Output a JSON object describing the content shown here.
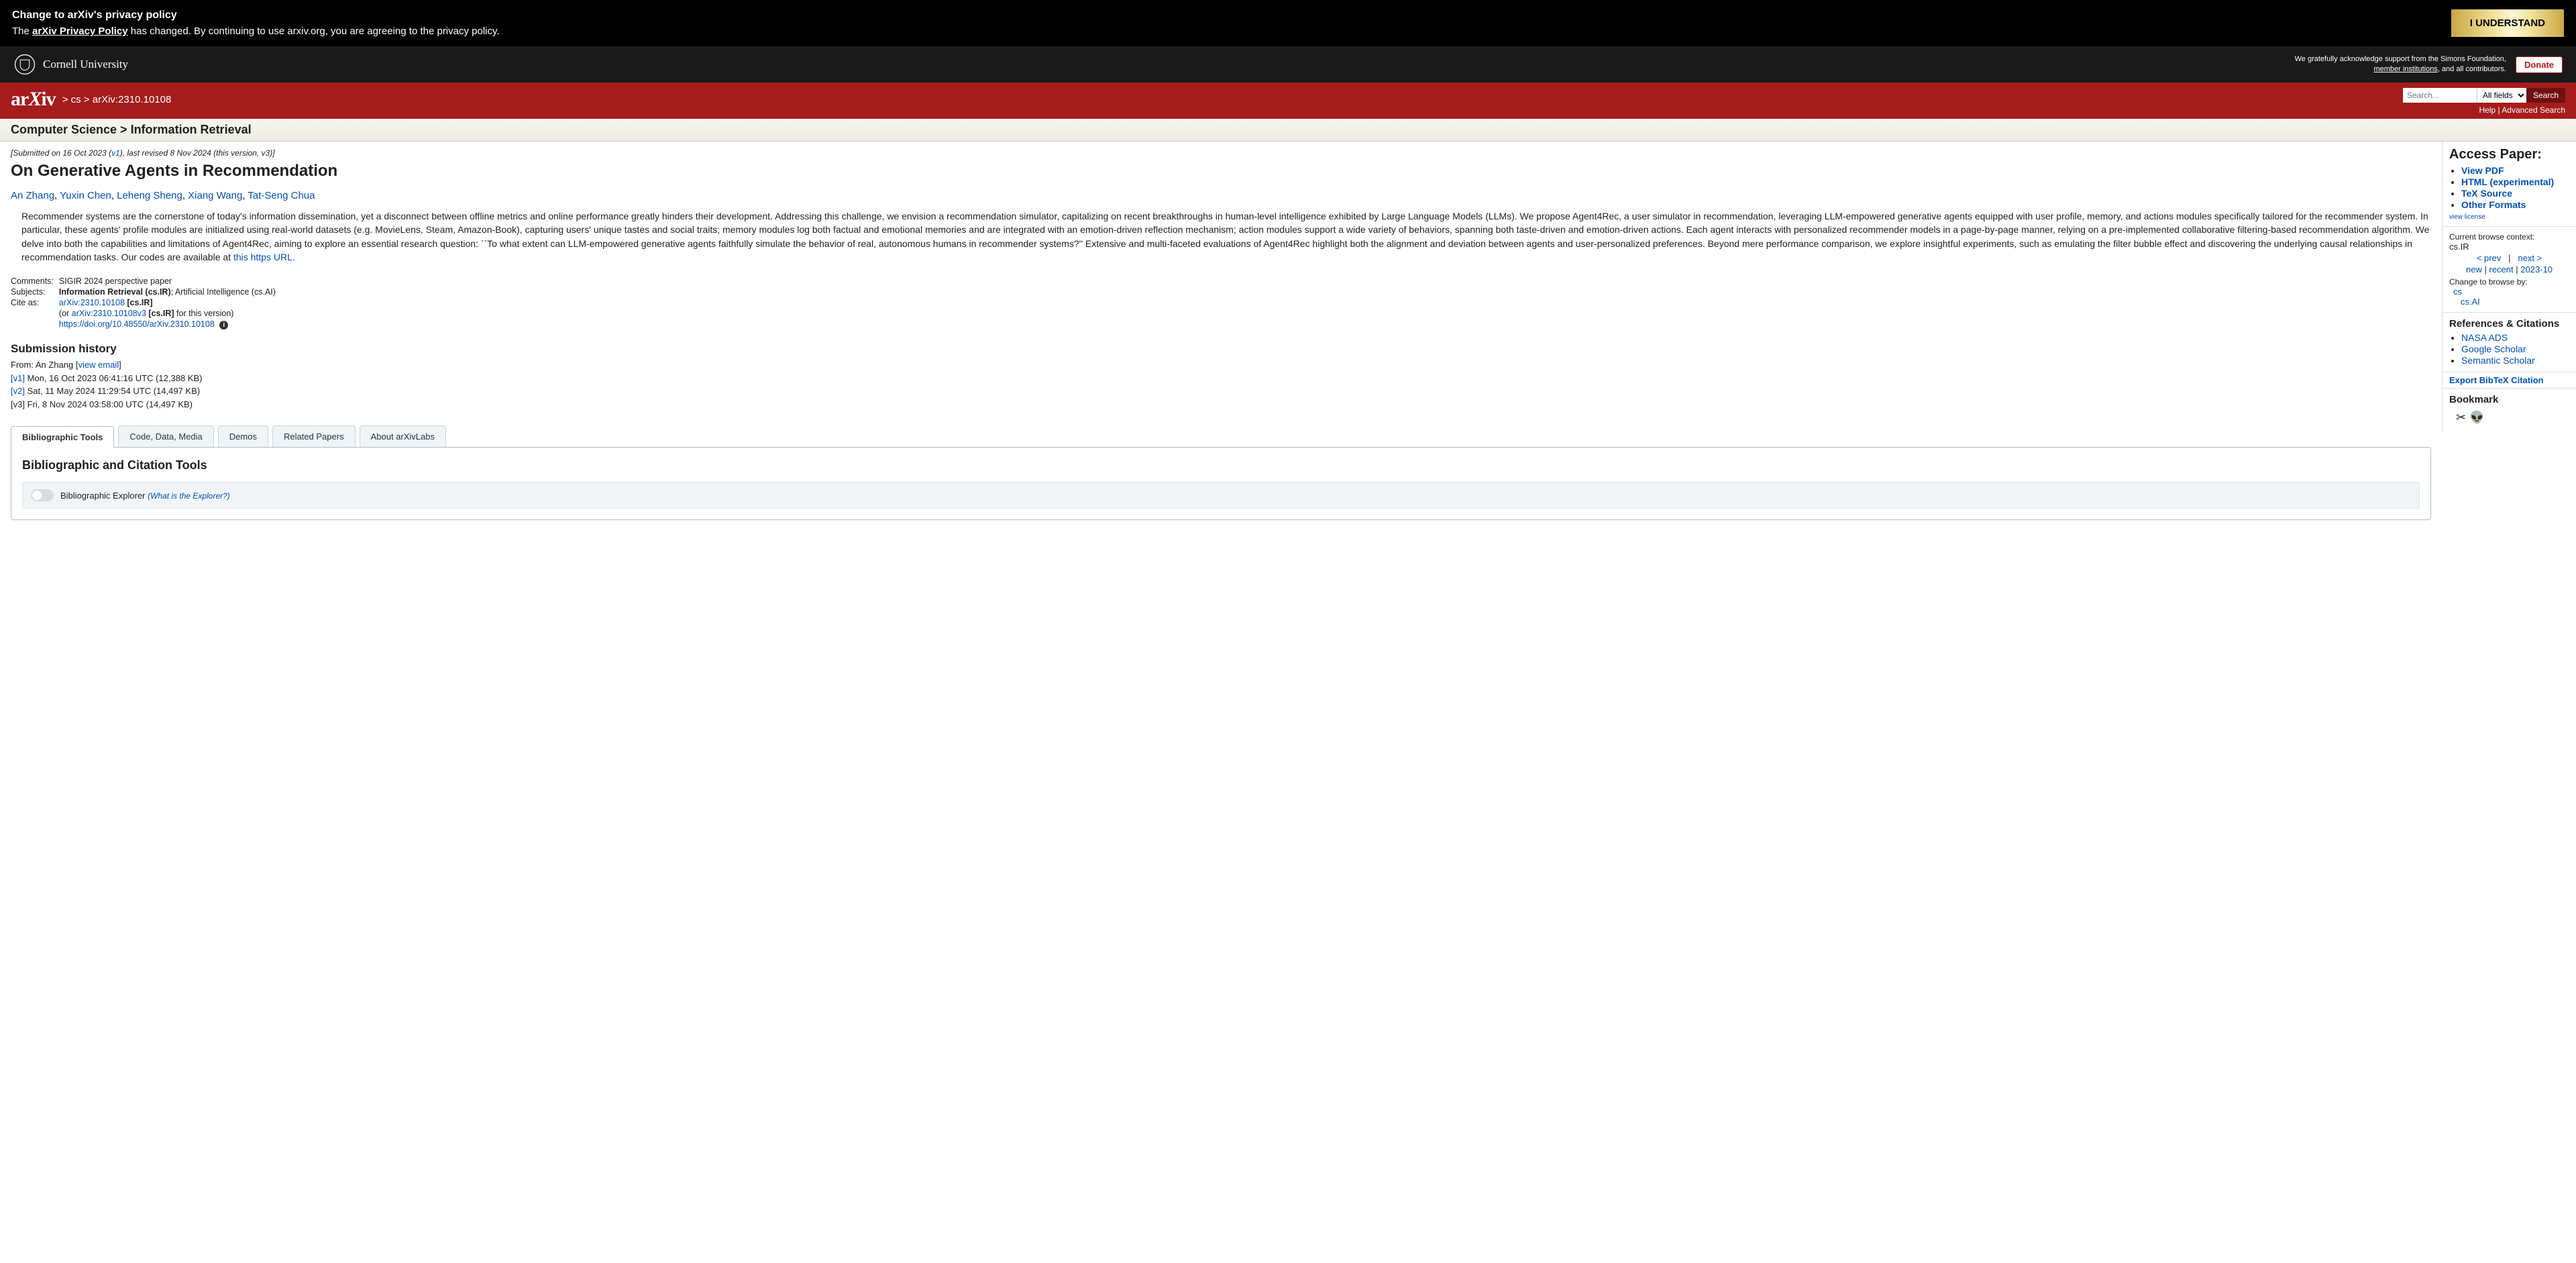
{
  "banner": {
    "title": "Change to arXiv's privacy policy",
    "text_pre": "The ",
    "policy_link": "arXiv Privacy Policy",
    "text_post": " has changed. By continuing to use arxiv.org, you are agreeing to the privacy policy.",
    "button": "I UNDERSTAND"
  },
  "cornell": {
    "name": "Cornell University",
    "ack_line1": "We gratefully acknowledge support from the Simons Foundation,",
    "member_link": "member institutions",
    "ack_line2_post": ", and all contributors.",
    "donate": "Donate"
  },
  "arxivbar": {
    "logo": "arXiv",
    "crumb_cs": "cs",
    "crumb_id": "arXiv:2310.10108",
    "search_placeholder": "Search...",
    "select_value": "All fields",
    "search_btn": "Search",
    "help": "Help",
    "advanced": "Advanced Search"
  },
  "category": {
    "main": "Computer Science",
    "sub": "Information Retrieval"
  },
  "submission": {
    "line_pre": "[Submitted on 16 Oct 2023 (",
    "v1": "v1",
    "line_post": "), last revised 8 Nov 2024 (this version, v3)]"
  },
  "title": "On Generative Agents in Recommendation",
  "authors": [
    "An Zhang",
    "Yuxin Chen",
    "Leheng Sheng",
    "Xiang Wang",
    "Tat-Seng Chua"
  ],
  "abstract": "Recommender systems are the cornerstone of today's information dissemination, yet a disconnect between offline metrics and online performance greatly hinders their development. Addressing this challenge, we envision a recommendation simulator, capitalizing on recent breakthroughs in human-level intelligence exhibited by Large Language Models (LLMs). We propose Agent4Rec, a user simulator in recommendation, leveraging LLM-empowered generative agents equipped with user profile, memory, and actions modules specifically tailored for the recommender system. In particular, these agents' profile modules are initialized using real-world datasets (e.g. MovieLens, Steam, Amazon-Book), capturing users' unique tastes and social traits; memory modules log both factual and emotional memories and are integrated with an emotion-driven reflection mechanism; action modules support a wide variety of behaviors, spanning both taste-driven and emotion-driven actions. Each agent interacts with personalized recommender models in a page-by-page manner, relying on a pre-implemented collaborative filtering-based recommendation algorithm. We delve into both the capabilities and limitations of Agent4Rec, aiming to explore an essential research question: ``To what extent can LLM-empowered generative agents faithfully simulate the behavior of real, autonomous humans in recommender systems?'' Extensive and multi-faceted evaluations of Agent4Rec highlight both the alignment and deviation between agents and user-personalized preferences. Beyond mere performance comparison, we explore insightful experiments, such as emulating the filter bubble effect and discovering the underlying causal relationships in recommendation tasks. Our codes are available at ",
  "abstract_link": "this https URL",
  "meta": {
    "comments_label": "Comments:",
    "comments": "SIGIR 2024 perspective paper",
    "subjects_label": "Subjects:",
    "subjects_bold": "Information Retrieval (cs.IR)",
    "subjects_rest": "; Artificial Intelligence (cs.AI)",
    "citeas_label": "Cite as:",
    "arxiv_id": "arXiv:2310.10108",
    "primary": " [cs.IR]",
    "or_pre": "(or ",
    "arxiv_v": "arXiv:2310.10108v3",
    "or_post": " for this version)",
    "doi": "https://doi.org/10.48550/arXiv.2310.10108"
  },
  "history": {
    "heading": "Submission history",
    "from_pre": "From: An Zhang [",
    "viewemail": "view email",
    "from_post": "]",
    "v1_link": "[v1]",
    "v1": " Mon, 16 Oct 2023 06:41:16 UTC (12,388 KB)",
    "v2_link": "[v2]",
    "v2": " Sat, 11 May 2024 11:29:54 UTC (14,497 KB)",
    "v3_label": "[v3]",
    "v3": " Fri, 8 Nov 2024 03:58:00 UTC (14,497 KB)"
  },
  "tabs": {
    "t0": "Bibliographic Tools",
    "t1": "Code, Data, Media",
    "t2": "Demos",
    "t3": "Related Papers",
    "t4": "About arXivLabs",
    "panel_title": "Bibliographic and Citation Tools",
    "be_label": "Bibliographic Explorer ",
    "be_what": "(What is the Explorer?)"
  },
  "sidebar": {
    "access": "Access Paper:",
    "pdf": "View PDF",
    "html": "HTML (experimental)",
    "tex": "TeX Source",
    "other": "Other Formats",
    "license": "view license",
    "ctx_label": "Current browse context:",
    "ctx_val": "cs.IR",
    "prev": "< prev",
    "next": "next >",
    "new": "new",
    "recent": "recent",
    "date": "2023-10",
    "browse_label": "Change to browse by:",
    "b1": "cs",
    "b2": "cs.AI",
    "ref": "References & Citations",
    "nasa": "NASA ADS",
    "gs": "Google Scholar",
    "ss": "Semantic Scholar",
    "export": "Export BibTeX Citation",
    "bookmark": "Bookmark"
  }
}
